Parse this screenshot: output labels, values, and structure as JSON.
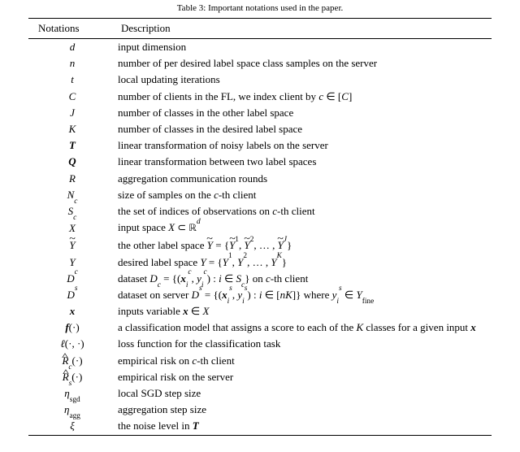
{
  "caption": "Table 3: Important notations used in the paper.",
  "headers": {
    "notation": "Notations",
    "description": "Description"
  },
  "chart_data": {
    "type": "table",
    "title": "Table 3: Important notations used in the paper.",
    "columns": [
      "Notations",
      "Description"
    ],
    "rows": [
      {
        "notation": "d",
        "description": "input dimension"
      },
      {
        "notation": "n",
        "description": "number of per desired label space class samples on the server"
      },
      {
        "notation": "t",
        "description": "local updating iterations"
      },
      {
        "notation": "C",
        "description": "number of clients in the FL, we index client by c ∈ [C]"
      },
      {
        "notation": "J",
        "description": "number of classes in the other label space"
      },
      {
        "notation": "K",
        "description": "number of classes in the desired label space"
      },
      {
        "notation": "T",
        "description": "linear transformation of noisy labels on the server"
      },
      {
        "notation": "Q",
        "description": "linear transformation between two label spaces"
      },
      {
        "notation": "R",
        "description": "aggregation communication rounds"
      },
      {
        "notation": "N_c",
        "description": "size of samples on the c-th client"
      },
      {
        "notation": "S_c",
        "description": "the set of indices of observations on c-th client"
      },
      {
        "notation": "X (cal)",
        "description": "input space 𝒳 ⊂ ℝ^d"
      },
      {
        "notation": "~Y (cal)",
        "description": "the other label space 𝒴̃ = {Ỹ^1, Ỹ^2, …, Ỹ^J}"
      },
      {
        "notation": "Y (cal)",
        "description": "desired label space 𝒴 = {Y^1, Y^2, …, Y^K}"
      },
      {
        "notation": "D^c (cal)",
        "description": "dataset 𝒟_c = {(x_i^c, y_i^c) : i ∈ S_c} on c-th client"
      },
      {
        "notation": "D^s (cal)",
        "description": "dataset on server 𝒟^s = {(x_i^s, y_i^s) : i ∈ [nK]} where y_i^s ∈ 𝒴_fine"
      },
      {
        "notation": "x",
        "description": "inputs variable x ∈ 𝒳"
      },
      {
        "notation": "f(·)",
        "description": "a classification model that assigns a score to each of the K classes for a given input x"
      },
      {
        "notation": "ℓ(·,·)",
        "description": "loss function for the classification task"
      },
      {
        "notation": "R̂_c(·)",
        "description": "empirical risk on c-th client"
      },
      {
        "notation": "R̂_s(·)",
        "description": "empirical risk on the server"
      },
      {
        "notation": "η_sgd",
        "description": "local SGD step size"
      },
      {
        "notation": "η_agg",
        "description": "aggregation step size"
      },
      {
        "notation": "ξ",
        "description": "the noise level in T"
      }
    ]
  }
}
